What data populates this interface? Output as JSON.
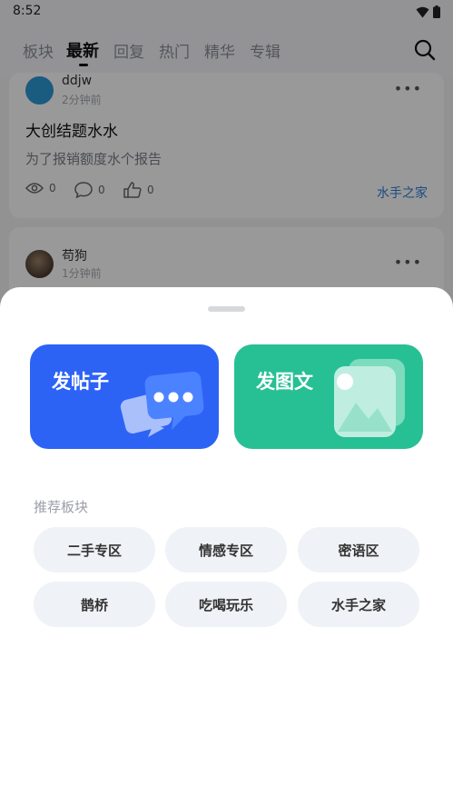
{
  "status_bar": {
    "time": "8:52"
  },
  "tabs": [
    {
      "label": "板块",
      "active": false
    },
    {
      "label": "最新",
      "active": true
    },
    {
      "label": "回复",
      "active": false
    },
    {
      "label": "热门",
      "active": false
    },
    {
      "label": "精华",
      "active": false
    },
    {
      "label": "专辑",
      "active": false
    }
  ],
  "posts": [
    {
      "username": "ddjw",
      "time": "2分钟前",
      "title": "大创结题水水",
      "body": "为了报销额度水个报告",
      "views": "0",
      "comments": "0",
      "likes": "0",
      "board": "水手之家"
    },
    {
      "username": "苟狗",
      "time": "1分钟前"
    }
  ],
  "sheet": {
    "actions": [
      {
        "label": "发帖子",
        "color": "#2d63f5"
      },
      {
        "label": "发图文",
        "color": "#27c095"
      }
    ],
    "section_title": "推荐板块",
    "boards": [
      "二手专区",
      "情感专区",
      "密语区",
      "鹊桥",
      "吃喝玩乐",
      "水手之家"
    ]
  },
  "colors": {
    "accent_blue": "#2d63f5",
    "accent_green": "#27c095",
    "link": "#2f7fd8"
  },
  "icons": [
    "wifi-icon",
    "battery-icon",
    "search-icon",
    "eye-icon",
    "comment-icon",
    "thumbs-up-icon",
    "more-icon",
    "chat-bubbles-icon",
    "image-icon"
  ]
}
